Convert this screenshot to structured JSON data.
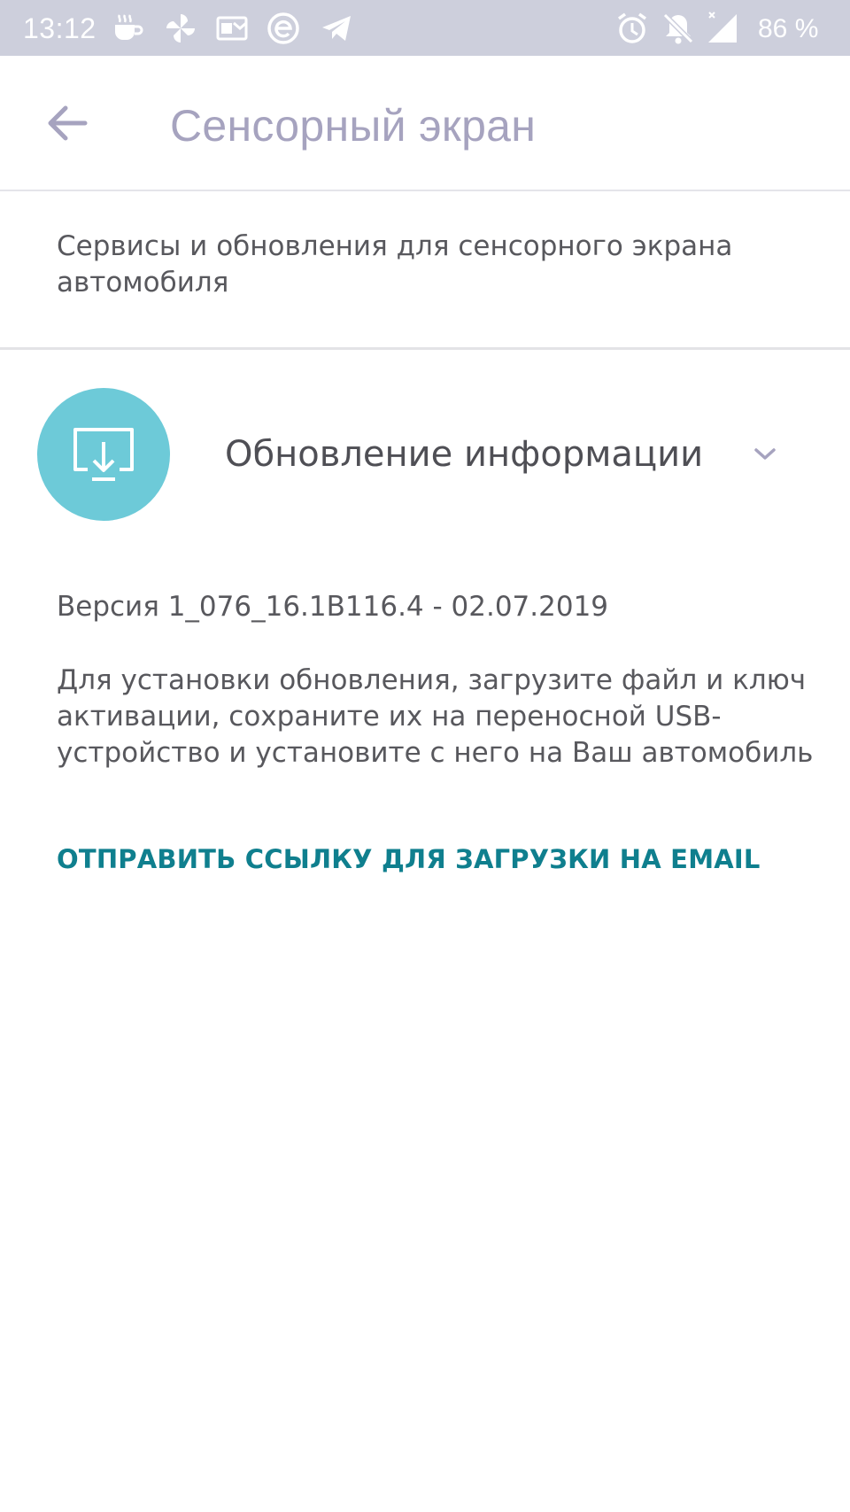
{
  "status_bar": {
    "time": "13:12",
    "battery": "86 %",
    "icons": [
      "coffee-icon",
      "pinwheel-icon",
      "mail-app-icon",
      "e-app-icon",
      "telegram-icon",
      "alarm-icon",
      "muted-bell-icon",
      "signal-icon"
    ]
  },
  "app_bar": {
    "title": "Сенсорный экран",
    "back_icon": "arrow-back-icon"
  },
  "description": "Сервисы и обновления для сенсорного экрана автомобиля",
  "update": {
    "icon": "screen-download-icon",
    "title": "Обновление информации",
    "expand_icon": "chevron-down-icon",
    "version": "Версия 1_076_16.1B116.4 - 02.07.2019",
    "instructions": "Для установки обновления, загрузите файл и ключ активации, сохраните их на переносной USB-устройство и установите с него на Ваш автомобиль",
    "send_link": "ОТПРАВИТЬ ССЫЛКУ ДЛЯ ЗАГРУЗКИ НА EMAIL"
  },
  "colors": {
    "status_bar": "#cdcfdc",
    "title": "#a6a3bf",
    "icon_circle": "#6dcad8",
    "link": "#0f7f8e",
    "text": "#58585d"
  }
}
